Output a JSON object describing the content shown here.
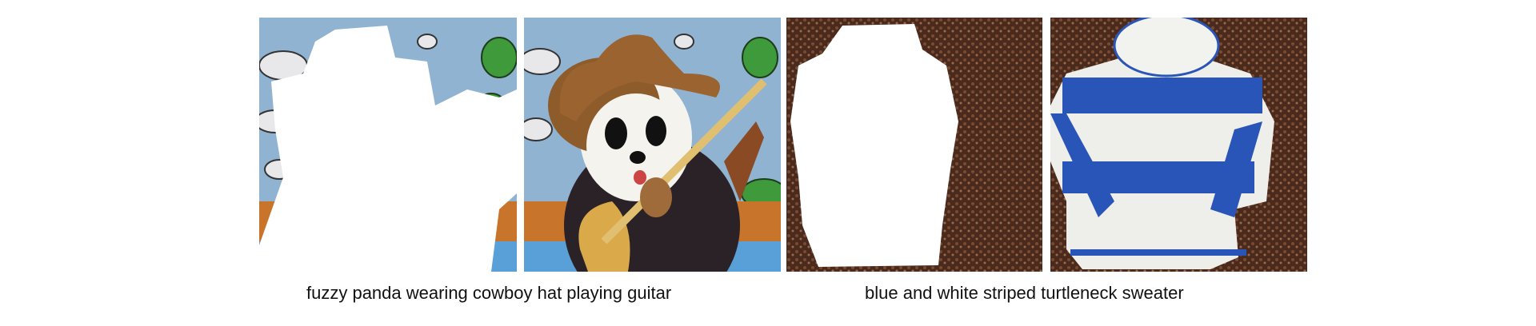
{
  "groups": [
    {
      "caption": "fuzzy panda wearing cowboy hat playing guitar"
    },
    {
      "caption": "blue and white striped turtleneck sweater"
    }
  ],
  "colors": {
    "sky": "#8fb3d0",
    "ground": "#c8742a",
    "soil": "#4a2a1c",
    "stripe_blue": "#2a55b8"
  }
}
